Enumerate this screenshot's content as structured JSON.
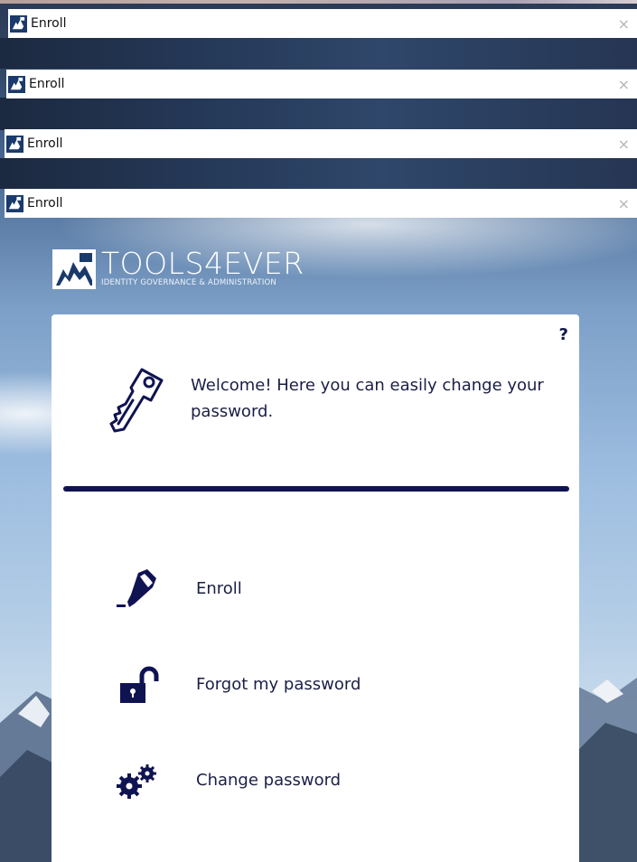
{
  "windows": [
    {
      "title": "Enroll",
      "close_label": "×"
    },
    {
      "title": "Enroll",
      "close_label": "×"
    },
    {
      "title": "Enroll",
      "close_label": "×"
    },
    {
      "title": "Enroll",
      "close_label": "×"
    }
  ],
  "brand": {
    "wordmark": "TOOLS4EVER",
    "tagline": "IDENTITY GOVERNANCE & ADMINISTRATION"
  },
  "card": {
    "help_label": "?",
    "welcome_text": "Welcome! Here you can easily change your password.",
    "menu": [
      {
        "label": "Enroll",
        "icon": "pencil-icon"
      },
      {
        "label": "Forgot my password",
        "icon": "unlocked-padlock-icon"
      },
      {
        "label": "Change password",
        "icon": "gears-icon"
      }
    ]
  },
  "colors": {
    "accent": "#0f1352",
    "text": "#1b1f45",
    "card_bg": "#ffffff"
  }
}
